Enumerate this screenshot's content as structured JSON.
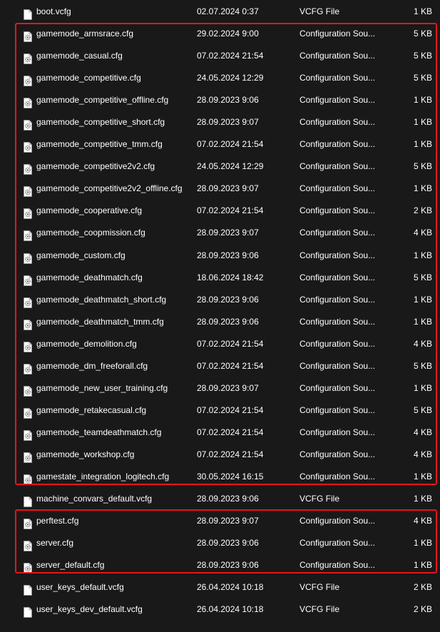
{
  "colors": {
    "background": "#191919",
    "text": "#ffffff",
    "highlight_border": "#e8141c"
  },
  "files": [
    {
      "name": "boot.vcfg",
      "date": "02.07.2024 0:37",
      "type": "VCFG File",
      "size": "1 KB",
      "icon": "file-icon"
    },
    {
      "name": "gamemode_armsrace.cfg",
      "date": "29.02.2024 9:00",
      "type": "Configuration Sou...",
      "size": "5 KB",
      "icon": "config-file-icon"
    },
    {
      "name": "gamemode_casual.cfg",
      "date": "07.02.2024 21:54",
      "type": "Configuration Sou...",
      "size": "5 KB",
      "icon": "config-file-icon"
    },
    {
      "name": "gamemode_competitive.cfg",
      "date": "24.05.2024 12:29",
      "type": "Configuration Sou...",
      "size": "5 KB",
      "icon": "config-file-icon"
    },
    {
      "name": "gamemode_competitive_offline.cfg",
      "date": "28.09.2023 9:06",
      "type": "Configuration Sou...",
      "size": "1 KB",
      "icon": "config-file-icon"
    },
    {
      "name": "gamemode_competitive_short.cfg",
      "date": "28.09.2023 9:07",
      "type": "Configuration Sou...",
      "size": "1 KB",
      "icon": "config-file-icon"
    },
    {
      "name": "gamemode_competitive_tmm.cfg",
      "date": "07.02.2024 21:54",
      "type": "Configuration Sou...",
      "size": "1 KB",
      "icon": "config-file-icon"
    },
    {
      "name": "gamemode_competitive2v2.cfg",
      "date": "24.05.2024 12:29",
      "type": "Configuration Sou...",
      "size": "5 KB",
      "icon": "config-file-icon"
    },
    {
      "name": "gamemode_competitive2v2_offline.cfg",
      "date": "28.09.2023 9:07",
      "type": "Configuration Sou...",
      "size": "1 KB",
      "icon": "config-file-icon"
    },
    {
      "name": "gamemode_cooperative.cfg",
      "date": "07.02.2024 21:54",
      "type": "Configuration Sou...",
      "size": "2 KB",
      "icon": "config-file-icon"
    },
    {
      "name": "gamemode_coopmission.cfg",
      "date": "28.09.2023 9:07",
      "type": "Configuration Sou...",
      "size": "4 KB",
      "icon": "config-file-icon"
    },
    {
      "name": "gamemode_custom.cfg",
      "date": "28.09.2023 9:06",
      "type": "Configuration Sou...",
      "size": "1 KB",
      "icon": "config-file-icon"
    },
    {
      "name": "gamemode_deathmatch.cfg",
      "date": "18.06.2024 18:42",
      "type": "Configuration Sou...",
      "size": "5 KB",
      "icon": "config-file-icon"
    },
    {
      "name": "gamemode_deathmatch_short.cfg",
      "date": "28.09.2023 9:06",
      "type": "Configuration Sou...",
      "size": "1 KB",
      "icon": "config-file-icon"
    },
    {
      "name": "gamemode_deathmatch_tmm.cfg",
      "date": "28.09.2023 9:06",
      "type": "Configuration Sou...",
      "size": "1 KB",
      "icon": "config-file-icon"
    },
    {
      "name": "gamemode_demolition.cfg",
      "date": "07.02.2024 21:54",
      "type": "Configuration Sou...",
      "size": "4 KB",
      "icon": "config-file-icon"
    },
    {
      "name": "gamemode_dm_freeforall.cfg",
      "date": "07.02.2024 21:54",
      "type": "Configuration Sou...",
      "size": "5 KB",
      "icon": "config-file-icon"
    },
    {
      "name": "gamemode_new_user_training.cfg",
      "date": "28.09.2023 9:07",
      "type": "Configuration Sou...",
      "size": "1 KB",
      "icon": "config-file-icon"
    },
    {
      "name": "gamemode_retakecasual.cfg",
      "date": "07.02.2024 21:54",
      "type": "Configuration Sou...",
      "size": "5 KB",
      "icon": "config-file-icon"
    },
    {
      "name": "gamemode_teamdeathmatch.cfg",
      "date": "07.02.2024 21:54",
      "type": "Configuration Sou...",
      "size": "4 KB",
      "icon": "config-file-icon"
    },
    {
      "name": "gamemode_workshop.cfg",
      "date": "07.02.2024 21:54",
      "type": "Configuration Sou...",
      "size": "4 KB",
      "icon": "config-file-icon"
    },
    {
      "name": "gamestate_integration_logitech.cfg",
      "date": "30.05.2024 16:15",
      "type": "Configuration Sou...",
      "size": "1 KB",
      "icon": "config-file-icon"
    },
    {
      "name": "machine_convars_default.vcfg",
      "date": "28.09.2023 9:06",
      "type": "VCFG File",
      "size": "1 KB",
      "icon": "file-icon"
    },
    {
      "name": "perftest.cfg",
      "date": "28.09.2023 9:07",
      "type": "Configuration Sou...",
      "size": "4 KB",
      "icon": "config-file-icon"
    },
    {
      "name": "server.cfg",
      "date": "28.09.2023 9:06",
      "type": "Configuration Sou...",
      "size": "1 KB",
      "icon": "config-file-icon"
    },
    {
      "name": "server_default.cfg",
      "date": "28.09.2023 9:06",
      "type": "Configuration Sou...",
      "size": "1 KB",
      "icon": "config-file-icon"
    },
    {
      "name": "user_keys_default.vcfg",
      "date": "26.04.2024 10:18",
      "type": "VCFG File",
      "size": "2 KB",
      "icon": "file-icon"
    },
    {
      "name": "user_keys_dev_default.vcfg",
      "date": "26.04.2024 10:18",
      "type": "VCFG File",
      "size": "2 KB",
      "icon": "file-icon"
    }
  ]
}
